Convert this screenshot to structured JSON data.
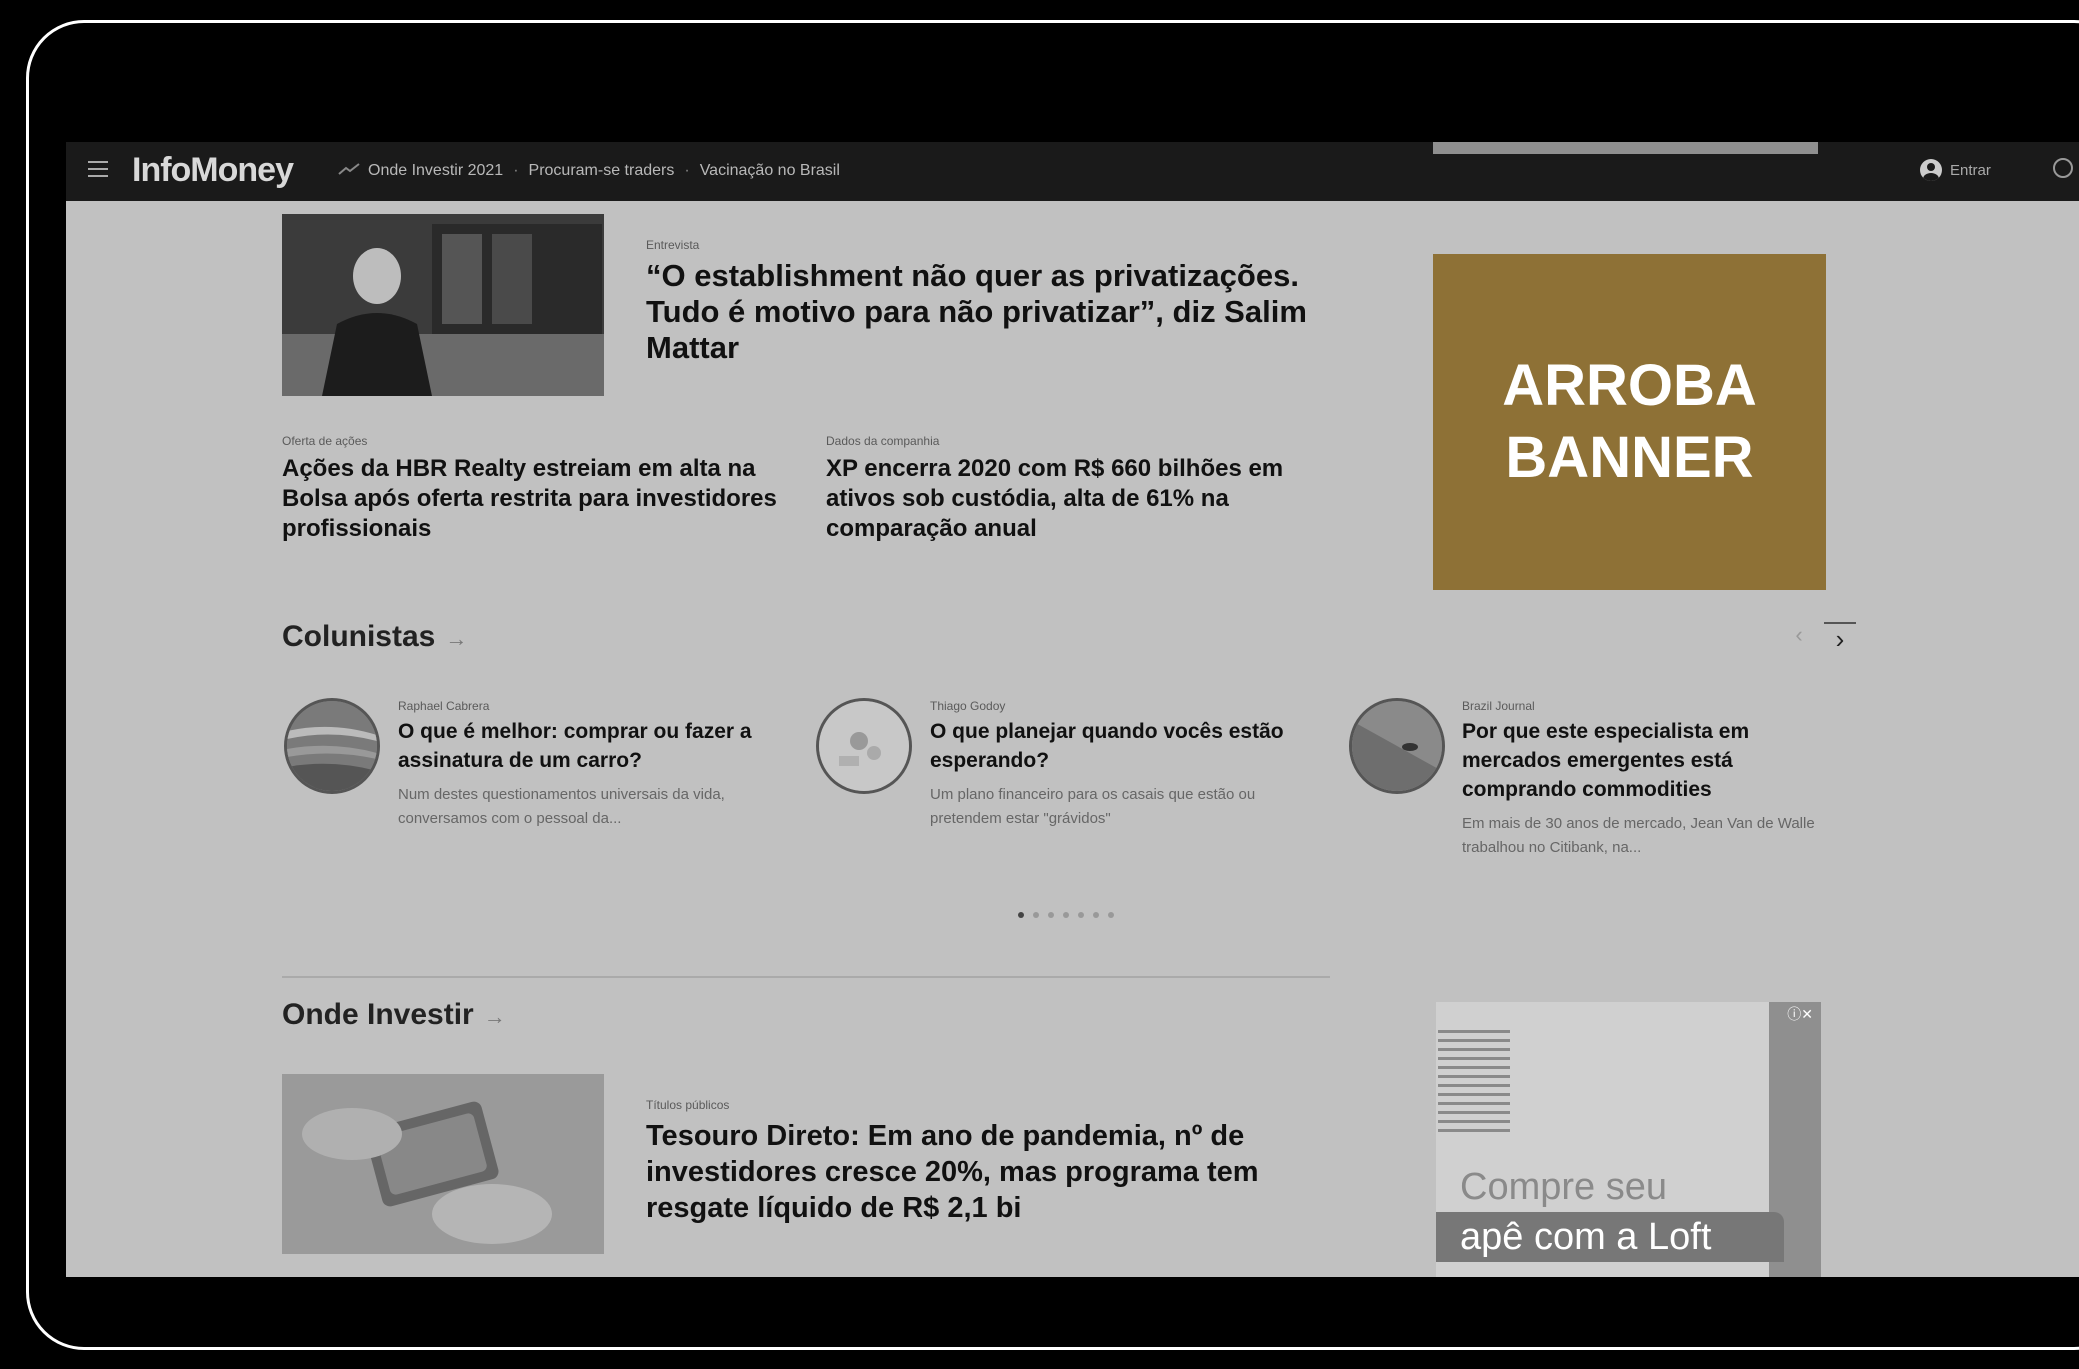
{
  "nav": {
    "logo": "InfoMoney",
    "links": [
      "Onde Investir 2021",
      "Procuram-se traders",
      "Vacinação no Brasil"
    ],
    "login": "Entrar"
  },
  "top_story": {
    "kicker": "Entrevista",
    "headline": "“O establishment não quer as privatizações. Tudo é motivo para não privatizar”, diz Salim Mattar"
  },
  "stories": [
    {
      "kicker": "Oferta de ações",
      "headline": "Ações da HBR Realty estreiam em alta na Bolsa após oferta restrita para investidores profissionais"
    },
    {
      "kicker": "Dados da companhia",
      "headline": "XP encerra 2020 com R$ 660 bilhões em ativos sob custódia, alta de 61% na comparação anual"
    }
  ],
  "banner": {
    "line1": "ARROBA",
    "line2": "BANNER"
  },
  "colunistas": {
    "title": "Colunistas",
    "arrow": "→",
    "prev": "‹",
    "next": "›",
    "items": [
      {
        "author": "Raphael Cabrera",
        "headline": "O que é melhor: comprar ou fazer a assinatura de um carro?",
        "excerpt": "Num destes questionamentos universais da vida, conversamos com o pessoal da..."
      },
      {
        "author": "Thiago Godoy",
        "headline": "O que planejar quando vocês estão esperando?",
        "excerpt": "Um plano financeiro para os casais que estão ou pretendem estar \"grávidos\""
      },
      {
        "author": "Brazil Journal",
        "headline": "Por que este especialista em mercados emergentes está comprando commodities",
        "excerpt": "Em mais de 30 anos de mercado, Jean Van de Walle trabalhou no Citibank, na..."
      }
    ]
  },
  "onde_investir": {
    "title": "Onde Investir",
    "arrow": "→",
    "kicker": "Títulos públicos",
    "headline": "Tesouro Direto: Em ano de pandemia, nº de investidores cresce 20%, mas programa tem resgate líquido de R$ 2,1 bi"
  },
  "ad": {
    "line1": "Compre seu",
    "line2": "apê com a Loft",
    "close": "ⓘ✕"
  },
  "colors": {
    "banner": "#8e7136",
    "nav_bg": "#1a1a1a",
    "page_bg": "#c1c1c1"
  }
}
